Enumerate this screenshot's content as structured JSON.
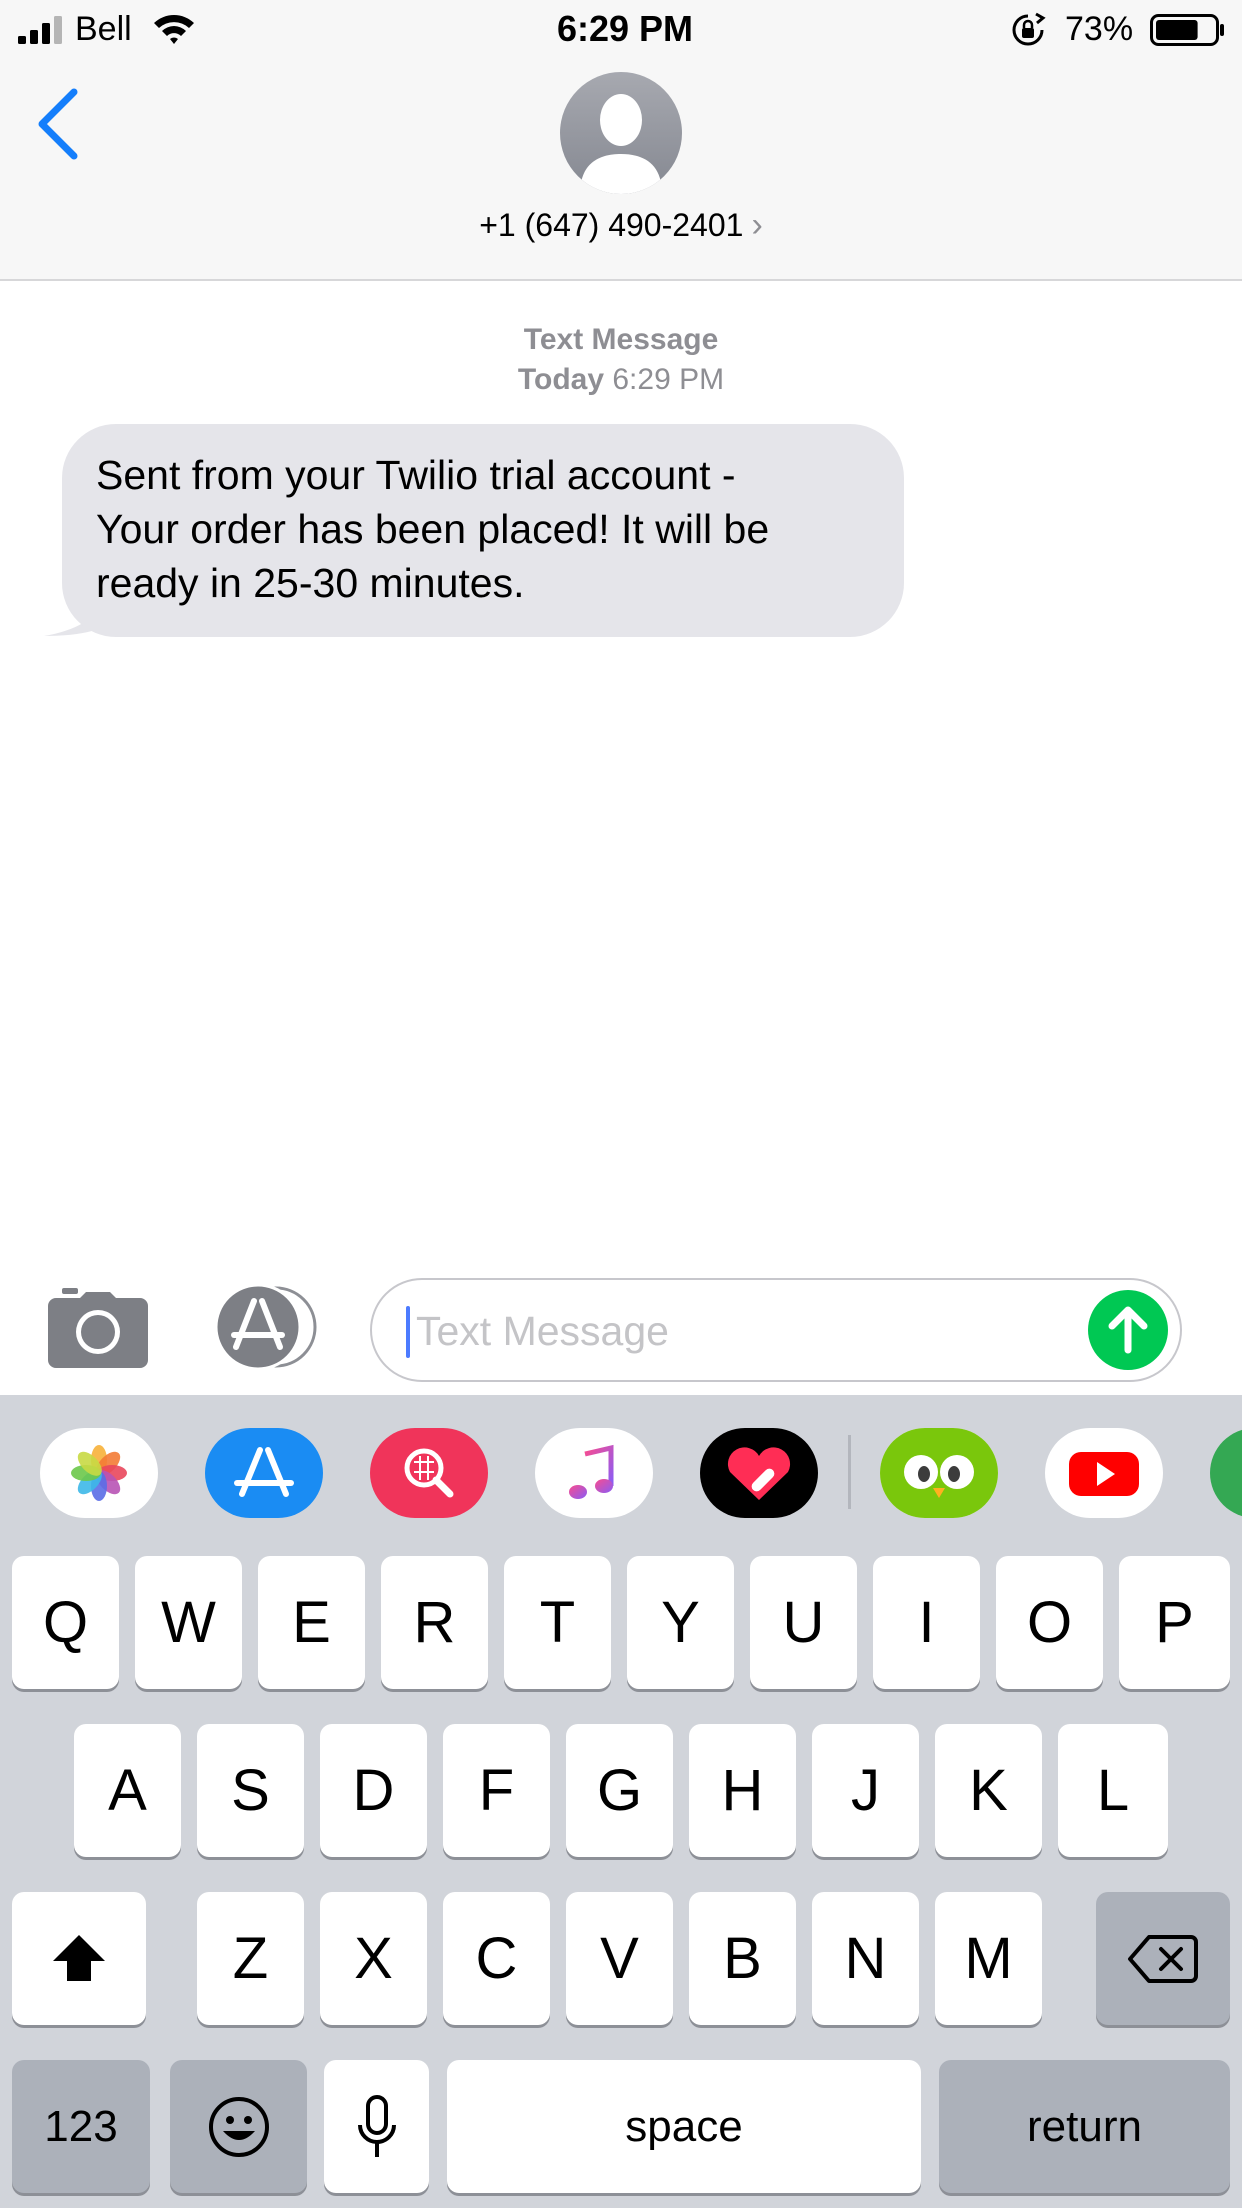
{
  "status_bar": {
    "carrier": "Bell",
    "time": "6:29 PM",
    "battery_percent": "73%",
    "battery_level": 0.73,
    "icons": [
      "signal-icon",
      "wifi-icon",
      "rotation-lock-icon",
      "battery-icon"
    ]
  },
  "header": {
    "back_icon": "chevron-left-icon",
    "contact_number": "+1 (647) 490-2401",
    "contact_chevron": "›"
  },
  "conversation": {
    "service": "Text Message",
    "day": "Today",
    "time": "6:29 PM",
    "messages": [
      {
        "direction": "incoming",
        "lines": [
          "Sent from your Twilio trial account -",
          "Your order has been placed! It will be",
          "ready in 25-30 minutes."
        ]
      }
    ]
  },
  "compose": {
    "placeholder": "Text Message",
    "camera_icon": "camera-icon",
    "apps_icon": "app-store-icon",
    "send_icon": "arrow-up-icon"
  },
  "app_drawer": {
    "apps": [
      "photos-app-icon",
      "app-store-app-icon",
      "search-images-app-icon",
      "music-app-icon",
      "digital-touch-app-icon",
      "duolingo-app-icon",
      "youtube-app-icon",
      "maps-app-icon"
    ]
  },
  "keyboard": {
    "row1": [
      "Q",
      "W",
      "E",
      "R",
      "T",
      "Y",
      "U",
      "I",
      "O",
      "P"
    ],
    "row2": [
      "A",
      "S",
      "D",
      "F",
      "G",
      "H",
      "J",
      "K",
      "L"
    ],
    "row3": [
      "Z",
      "X",
      "C",
      "V",
      "B",
      "N",
      "M"
    ],
    "numbers_label": "123",
    "space_label": "space",
    "return_label": "return",
    "shift_icon": "shift-icon",
    "delete_icon": "delete-icon",
    "emoji_icon": "emoji-icon",
    "mic_icon": "microphone-icon"
  },
  "colors": {
    "accent_blue": "#147efb",
    "incoming_bubble": "#e5e5ea",
    "send_green": "#00c853",
    "keyboard_bg": "#d1d4da",
    "dark_key": "#acb1ba"
  }
}
